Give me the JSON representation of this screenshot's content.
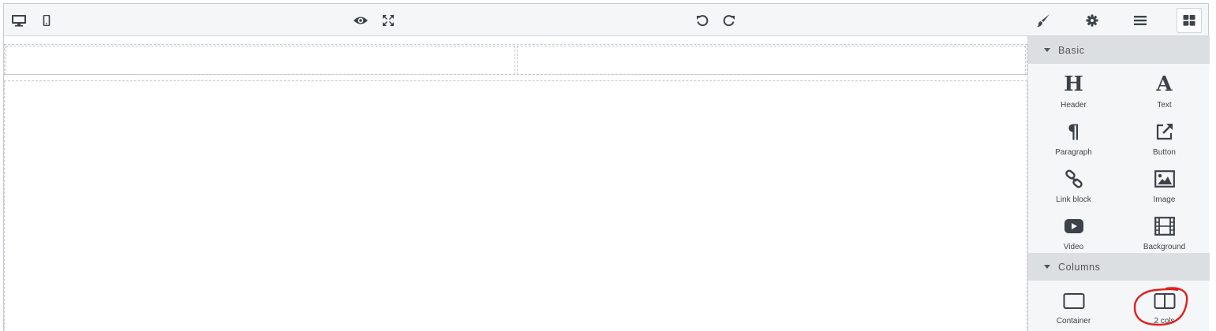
{
  "categories": [
    {
      "title": "Basic"
    },
    {
      "title": "Columns"
    }
  ],
  "basic_blocks": [
    {
      "label": "Header",
      "glyph": "H"
    },
    {
      "label": "Text",
      "glyph": "A"
    },
    {
      "label": "Paragraph",
      "glyph": "¶"
    },
    {
      "label": "Button"
    },
    {
      "label": "Link block"
    },
    {
      "label": "Image"
    },
    {
      "label": "Video"
    },
    {
      "label": "Background"
    }
  ],
  "column_blocks": [
    {
      "label": "Container"
    },
    {
      "label": "2 cols"
    }
  ],
  "colors": {
    "annotation": "#e02020",
    "toolbar_bg": "#f4f6f8",
    "category_bg": "#dcdfe2",
    "icon": "#3c4248"
  }
}
